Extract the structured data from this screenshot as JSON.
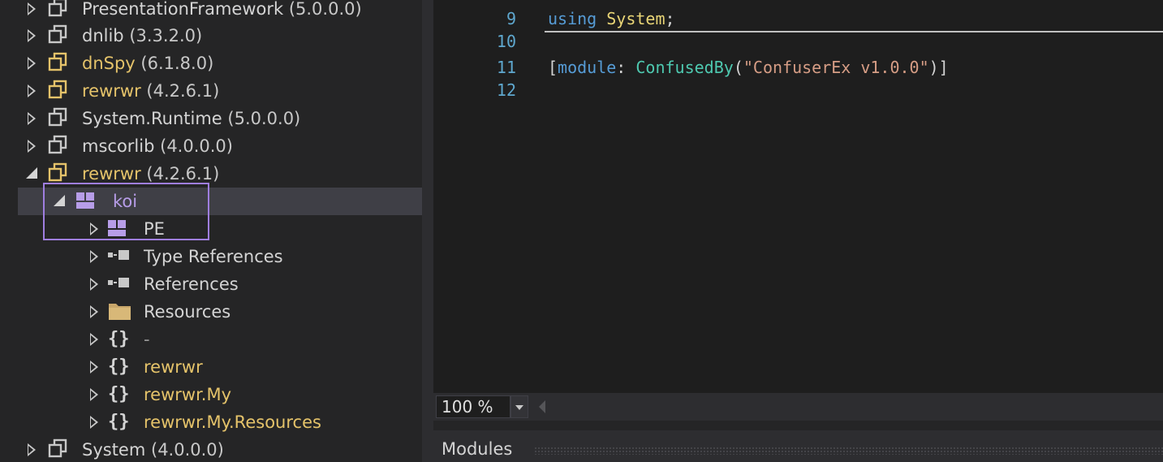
{
  "tree": {
    "items": [
      {
        "name": "PresentationFramework",
        "version": "(5.0.0.0)"
      },
      {
        "name": "dnlib",
        "version": "(3.3.2.0)"
      },
      {
        "name": "dnSpy",
        "version": "(6.1.8.0)"
      },
      {
        "name": "rewrwr",
        "version": "(4.2.6.1)"
      },
      {
        "name": "System.Runtime",
        "version": "(5.0.0.0)"
      },
      {
        "name": "mscorlib",
        "version": "(4.0.0.0)"
      },
      {
        "name": "rewrwr",
        "version": "(4.2.6.1)"
      },
      {
        "name": "koi"
      },
      {
        "name": "PE"
      },
      {
        "name": "Type References"
      },
      {
        "name": "References"
      },
      {
        "name": "Resources"
      },
      {
        "name": "-"
      },
      {
        "name": "rewrwr"
      },
      {
        "name": "rewrwr.My"
      },
      {
        "name": "rewrwr.My.Resources"
      },
      {
        "name": "System",
        "version": "(4.0.0.0)"
      }
    ]
  },
  "editor": {
    "lines": [
      {
        "num": "9"
      },
      {
        "num": "10"
      },
      {
        "num": "11"
      },
      {
        "num": "12"
      }
    ],
    "code": {
      "line9_kw": "using",
      "line9_ns": "System",
      "line9_end": ";",
      "line11_open": "[",
      "line11_kw": "module",
      "line11_colon": ": ",
      "line11_attr": "ConfusedBy",
      "line11_paren_open": "(",
      "line11_str": "\"ConfuserEx v1.0.0\"",
      "line11_close": ")]"
    }
  },
  "zoom": {
    "value": "100 %"
  },
  "modules": {
    "title": "Modules"
  },
  "colors": {
    "selection_outline": "#9f7ee0",
    "assembly_yellow": "#e5c36a",
    "module_purple": "#b79de8",
    "keyword": "#569cd6",
    "type": "#e9d576",
    "class": "#4ec9b0",
    "string": "#d69d85"
  }
}
